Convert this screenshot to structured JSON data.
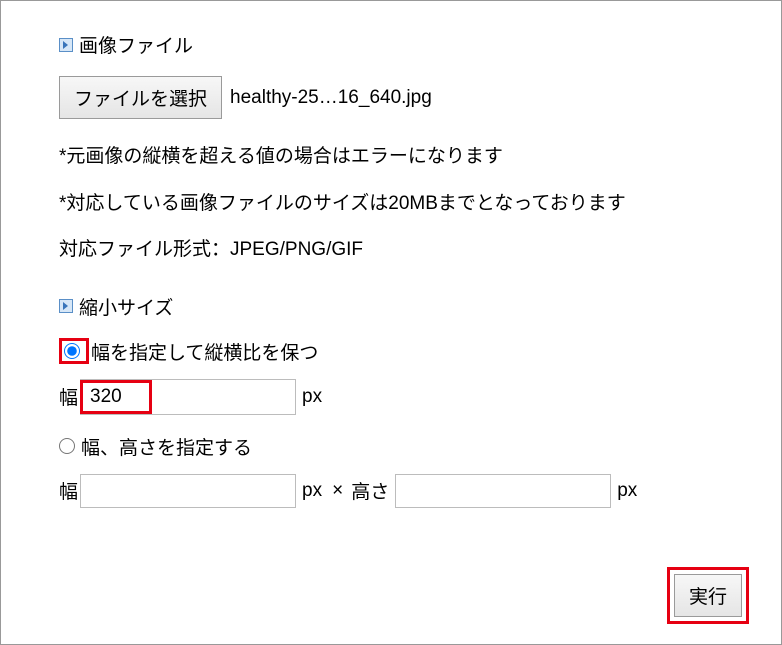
{
  "section1": {
    "title": "画像ファイル",
    "file_button": "ファイルを選択",
    "file_name": "healthy-25…16_640.jpg",
    "note1": "*元画像の縦横を超える値の場合はエラーになります",
    "note2": "*対応している画像ファイルのサイズは20MBまでとなっております",
    "note3": "対応ファイル形式：JPEG/PNG/GIF"
  },
  "section2": {
    "title": "縮小サイズ",
    "radio1_label": "幅を指定して縦横比を保つ",
    "width1_label": "幅",
    "width1_value": "320",
    "unit_px": "px",
    "radio2_label": "幅、高さを指定する",
    "width2_label": "幅",
    "height2_label": "高さ",
    "times": " × ",
    "width2_value": "",
    "height2_value": ""
  },
  "submit_label": "実行"
}
